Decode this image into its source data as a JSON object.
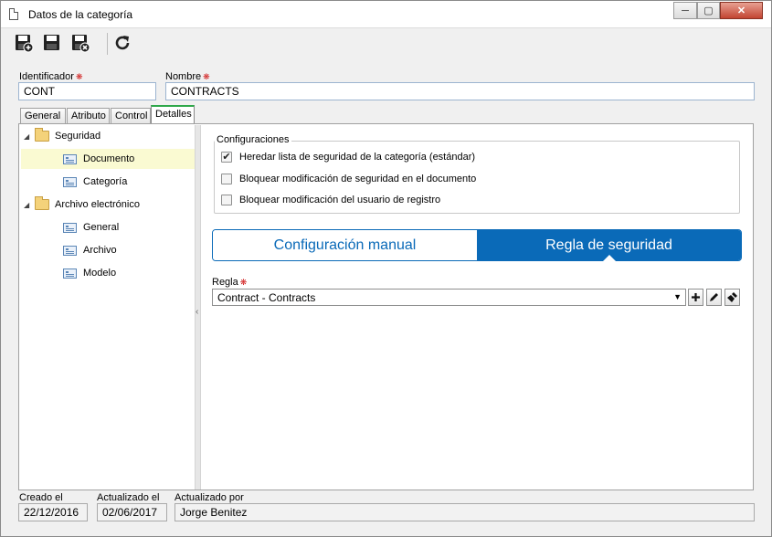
{
  "window": {
    "title": "Datos de la categoría",
    "controls": {
      "minimize": "─",
      "maximize": "▢",
      "close": "✕"
    }
  },
  "toolbar": {
    "buttons": [
      {
        "name": "save-new",
        "icon": "save-plus-icon"
      },
      {
        "name": "save",
        "icon": "save-icon"
      },
      {
        "name": "save-close",
        "icon": "save-close-icon"
      },
      {
        "name": "refresh",
        "icon": "refresh-icon"
      }
    ]
  },
  "fields": {
    "identificador": {
      "label": "Identificador",
      "value": "CONT"
    },
    "nombre": {
      "label": "Nombre",
      "value": "CONTRACTS"
    },
    "required_mark": "❋"
  },
  "tabs": [
    {
      "label": "General"
    },
    {
      "label": "Atributo"
    },
    {
      "label": "Control"
    },
    {
      "label": "Detalles",
      "active": true
    }
  ],
  "tree": [
    {
      "label": "Seguridad",
      "type": "folder",
      "expanded": true
    },
    {
      "label": "Documento",
      "type": "item",
      "selected": true
    },
    {
      "label": "Categoría",
      "type": "item"
    },
    {
      "label": "Archivo electrónico",
      "type": "folder",
      "expanded": true
    },
    {
      "label": "General",
      "type": "item"
    },
    {
      "label": "Archivo",
      "type": "item"
    },
    {
      "label": "Modelo",
      "type": "item"
    }
  ],
  "configuraciones": {
    "legend": "Configuraciones",
    "options": [
      {
        "label": "Heredar lista de seguridad de la categoría (estándar)",
        "checked": true
      },
      {
        "label": "Bloquear modificación de seguridad en el documento",
        "checked": false
      },
      {
        "label": "Bloquear modificación del usuario de registro",
        "checked": false
      }
    ]
  },
  "segment": {
    "manual": "Configuración manual",
    "regla": "Regla de seguridad",
    "active": "regla"
  },
  "regla": {
    "label": "Regla",
    "value": "Contract - Contracts"
  },
  "footer": {
    "creado": {
      "label": "Creado el",
      "value": "22/12/2016"
    },
    "actualizado": {
      "label": "Actualizado el",
      "value": "02/06/2017"
    },
    "actualizado_por": {
      "label": "Actualizado por",
      "value": "Jorge Benitez"
    }
  },
  "colors": {
    "accent": "#0a6ab8",
    "tab_active": "#2fa84a",
    "selected_row": "#fafad2"
  }
}
